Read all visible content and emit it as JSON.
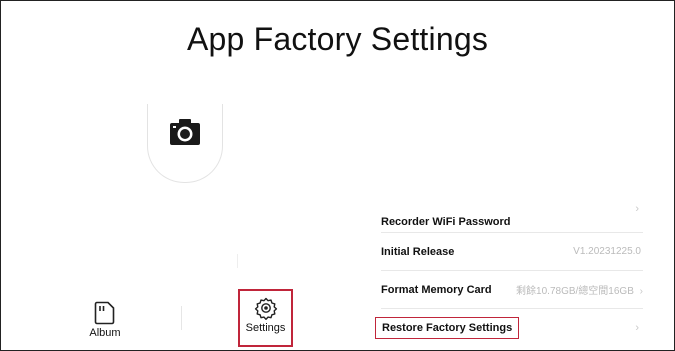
{
  "page": {
    "title": "App Factory Settings"
  },
  "camera": {
    "icon": "camera-icon"
  },
  "nav": {
    "album_label": "Album",
    "album_icon": "sd-card-icon",
    "settings_label": "Settings",
    "settings_icon": "gear-icon"
  },
  "settings": {
    "wifi_password_label": "Recorder WiFi Password",
    "initial_release_label": "Initial Release",
    "initial_release_value": "V1.20231225.0",
    "format_card_label": "Format Memory Card",
    "format_card_value": "剩餘10.78GB/總空間16GB",
    "restore_label": "Restore Factory Settings",
    "arrow": "›"
  },
  "colors": {
    "highlight": "#c0253a",
    "text": "#111111",
    "muted": "#bbbbbb"
  }
}
